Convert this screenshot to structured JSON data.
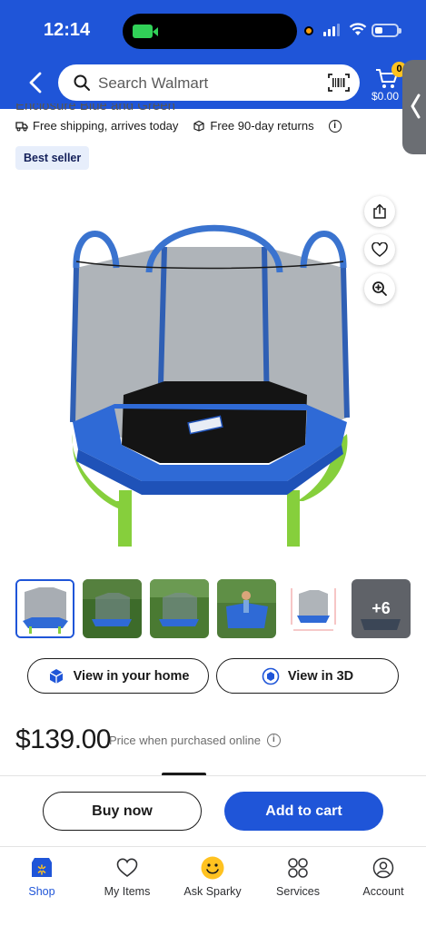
{
  "status_bar": {
    "time": "12:14"
  },
  "header": {
    "search_placeholder": "Search Walmart",
    "cart_count": "0",
    "cart_total": "$0.00"
  },
  "product": {
    "title_fragment": "Enclosure Blue and Green",
    "shipping_text": "Free shipping, arrives today",
    "returns_text": "Free 90-day returns",
    "badge": "Best seller",
    "more_images_label": "+6",
    "view_home_label": "View in your home",
    "view_3d_label": "View in 3D",
    "price": "$139.00",
    "price_note": "Price when purchased online"
  },
  "actions": {
    "buy_now": "Buy now",
    "add_to_cart": "Add to cart"
  },
  "tabs": [
    {
      "label": "Shop",
      "icon": "shop-icon",
      "active": true
    },
    {
      "label": "My Items",
      "icon": "heart-icon",
      "active": false
    },
    {
      "label": "Ask Sparky",
      "icon": "sparky-icon",
      "active": false
    },
    {
      "label": "Services",
      "icon": "services-icon",
      "active": false
    },
    {
      "label": "Account",
      "icon": "account-icon",
      "active": false
    }
  ],
  "colors": {
    "brand_blue": "#1f55d8",
    "badge_bg": "#e7eefb",
    "sparky_yellow": "#ffc220"
  }
}
